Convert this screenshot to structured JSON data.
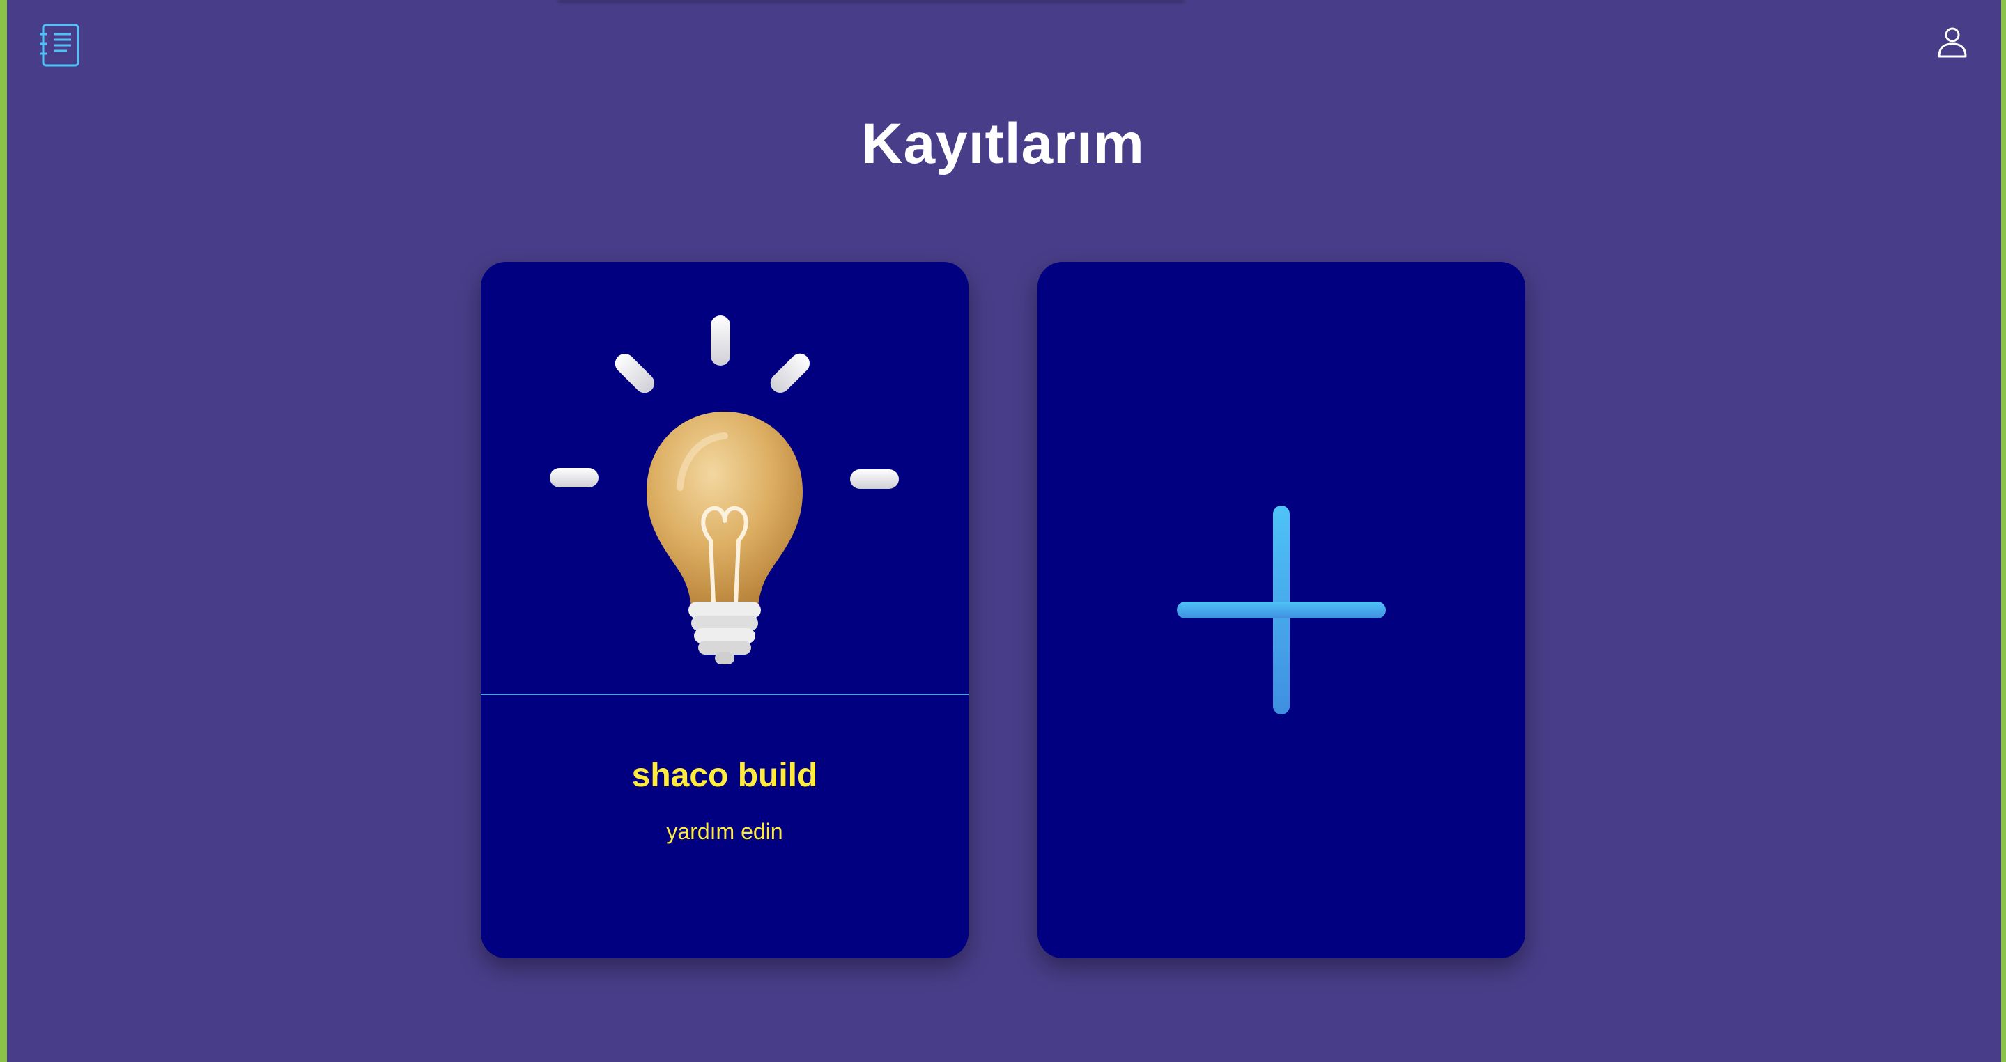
{
  "header": {
    "title": "Kayıtlarım",
    "left_icon": "notebook-list-icon",
    "right_icon": "user-profile-icon"
  },
  "records": [
    {
      "title": "shaco build",
      "description": "yardım edin",
      "image": "lightbulb-illustration"
    }
  ],
  "add_card": {
    "icon": "plus-icon"
  },
  "colors": {
    "background": "#483d88",
    "card": "#000080",
    "accent_text": "#ffeb3b",
    "icon_blue": "#4fc3f7",
    "side_accent": "#8bc34a"
  }
}
